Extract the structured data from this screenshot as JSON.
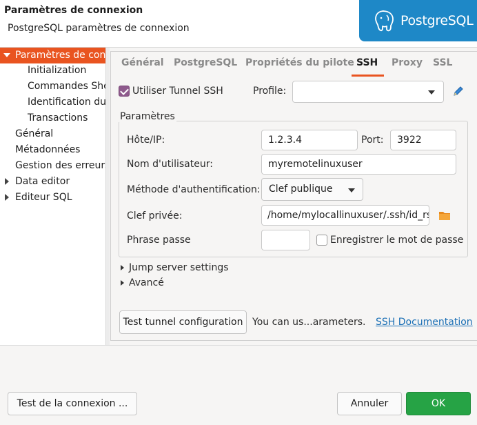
{
  "header": {
    "title": "Paramètres de connexion",
    "subtitle": "PostgreSQL paramètres de connexion",
    "logo_text": "PostgreSQL",
    "logo_color": "#1e88c7"
  },
  "tree": {
    "items": [
      {
        "label": "Paramètres de conn",
        "level": 0,
        "expanded": true,
        "selected": true
      },
      {
        "label": "Initialization",
        "level": 1
      },
      {
        "label": "Commandes She",
        "level": 1
      },
      {
        "label": "Identification du",
        "level": 1
      },
      {
        "label": "Transactions",
        "level": 1
      },
      {
        "label": "Général",
        "level": 0
      },
      {
        "label": "Métadonnées",
        "level": 0
      },
      {
        "label": "Gestion des erreurs",
        "level": 0
      },
      {
        "label": "Data editor",
        "level": 0,
        "expandable": true
      },
      {
        "label": "Editeur SQL",
        "level": 0,
        "expandable": true
      }
    ],
    "selected_color": "#e95420"
  },
  "tabs": [
    {
      "label": "Général"
    },
    {
      "label": "PostgreSQL"
    },
    {
      "label": "Propriétés du pilote"
    },
    {
      "label": "SSH",
      "active": true
    },
    {
      "label": "Proxy"
    },
    {
      "label": "SSL"
    }
  ],
  "ssh": {
    "use_tunnel_label": "Utiliser Tunnel SSH",
    "use_tunnel_checked": true,
    "profile_label": "Profile:",
    "profile_value": "",
    "edit_icon": "pencil-icon",
    "params_title": "Paramètres",
    "host_label": "Hôte/IP:",
    "host_value": "1.2.3.4",
    "port_label": "Port:",
    "port_value": "3922",
    "user_label": "Nom d'utilisateur:",
    "user_value": "myremotelinuxuser",
    "auth_label": "Méthode d'authentification:",
    "auth_value": "Clef publique",
    "key_label": "Clef privée:",
    "key_value": "/home/mylocallinuxuser/.ssh/id_rs",
    "folder_icon": "folder-icon",
    "passphrase_label": "Phrase passe",
    "passphrase_value": "",
    "save_password_label": "Enregistrer le mot de passe",
    "save_password_checked": false,
    "jump_label": "Jump server settings",
    "advanced_label": "Avancé",
    "test_button": "Test tunnel configuration",
    "info_text": "You can us...arameters.",
    "doc_link": "SSH Documentation"
  },
  "footer": {
    "test_button": "Test de la connexion ...",
    "cancel_button": "Annuler",
    "ok_button": "OK",
    "ok_color": "#26a345"
  }
}
